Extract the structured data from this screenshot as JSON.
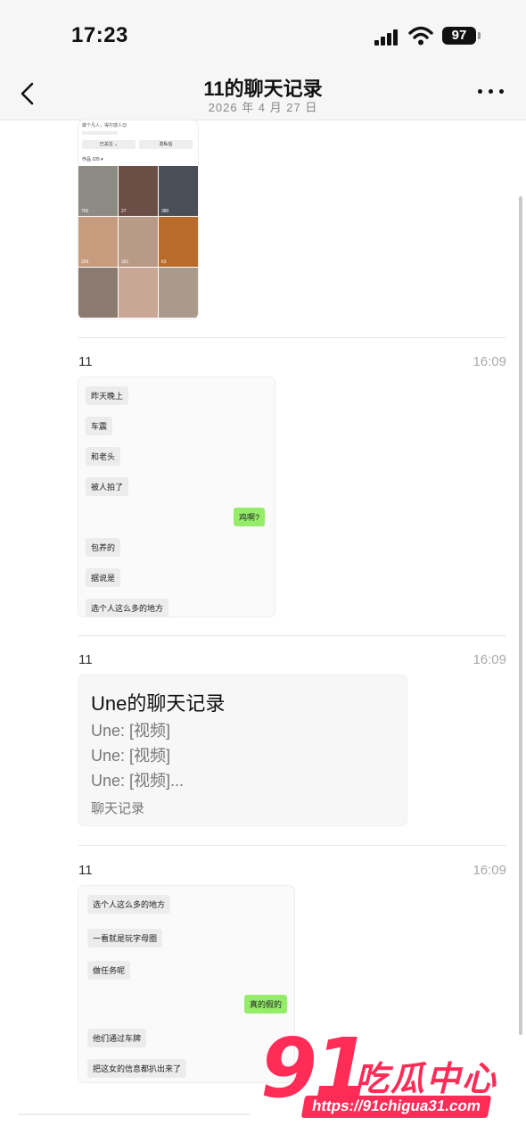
{
  "status_bar": {
    "time": "17:23",
    "battery": "97"
  },
  "nav": {
    "title": "11的聊天记录",
    "subtitle": "2026 年 4 月 27 日"
  },
  "profile_snippet": {
    "bio": "做个凡人，得尔感人😊",
    "follow_btn": "已关注 ⌄",
    "message_btn": "发私信",
    "works": "作品 105 ▾",
    "tiles": [
      {
        "likes": "755",
        "color": "#8d8a84"
      },
      {
        "likes": "27",
        "color": "#6b4e46"
      },
      {
        "likes": "380",
        "color": "#4a4f57"
      },
      {
        "likes": "209",
        "color": "#c79b7e"
      },
      {
        "likes": "351",
        "color": "#b89a86"
      },
      {
        "likes": "63",
        "color": "#b96b2c"
      },
      {
        "likes": "",
        "color": "#8a7a70"
      },
      {
        "likes": "",
        "color": "#c9a795"
      },
      {
        "likes": "",
        "color": "#a99a8c"
      }
    ]
  },
  "messages": [
    {
      "sender": "11",
      "time": "16:09",
      "chat": [
        {
          "text": "昨天晚上",
          "side": "left"
        },
        {
          "text": "车震",
          "side": "left"
        },
        {
          "text": "和老头",
          "side": "left"
        },
        {
          "text": "被人拍了",
          "side": "left"
        },
        {
          "text": "鸡啊?",
          "side": "right"
        },
        {
          "text": "包养的",
          "side": "left"
        },
        {
          "text": "据说是",
          "side": "left"
        },
        {
          "text": "选个人这么多的地方",
          "side": "left"
        }
      ]
    },
    {
      "sender": "11",
      "time": "16:09",
      "forward": {
        "title": "Une的聊天记录",
        "lines": [
          "Une: [视频]",
          "Une: [视频]",
          "Une: [视频]..."
        ],
        "footer": "聊天记录"
      }
    },
    {
      "sender": "11",
      "time": "16:09",
      "chat": [
        {
          "text": "选个人这么多的地方",
          "side": "left"
        },
        {
          "text": "一看就是玩字母圈",
          "side": "left"
        },
        {
          "text": "做任务呢",
          "side": "left"
        },
        {
          "text": "真的假的",
          "side": "right"
        },
        {
          "text": "他们通过车牌",
          "side": "left"
        },
        {
          "text": "把这女的信息都扒出来了",
          "side": "left"
        }
      ]
    }
  ],
  "watermark": {
    "number": "91",
    "name": "吃瓜中心",
    "url": "https://91chigua31.com"
  }
}
